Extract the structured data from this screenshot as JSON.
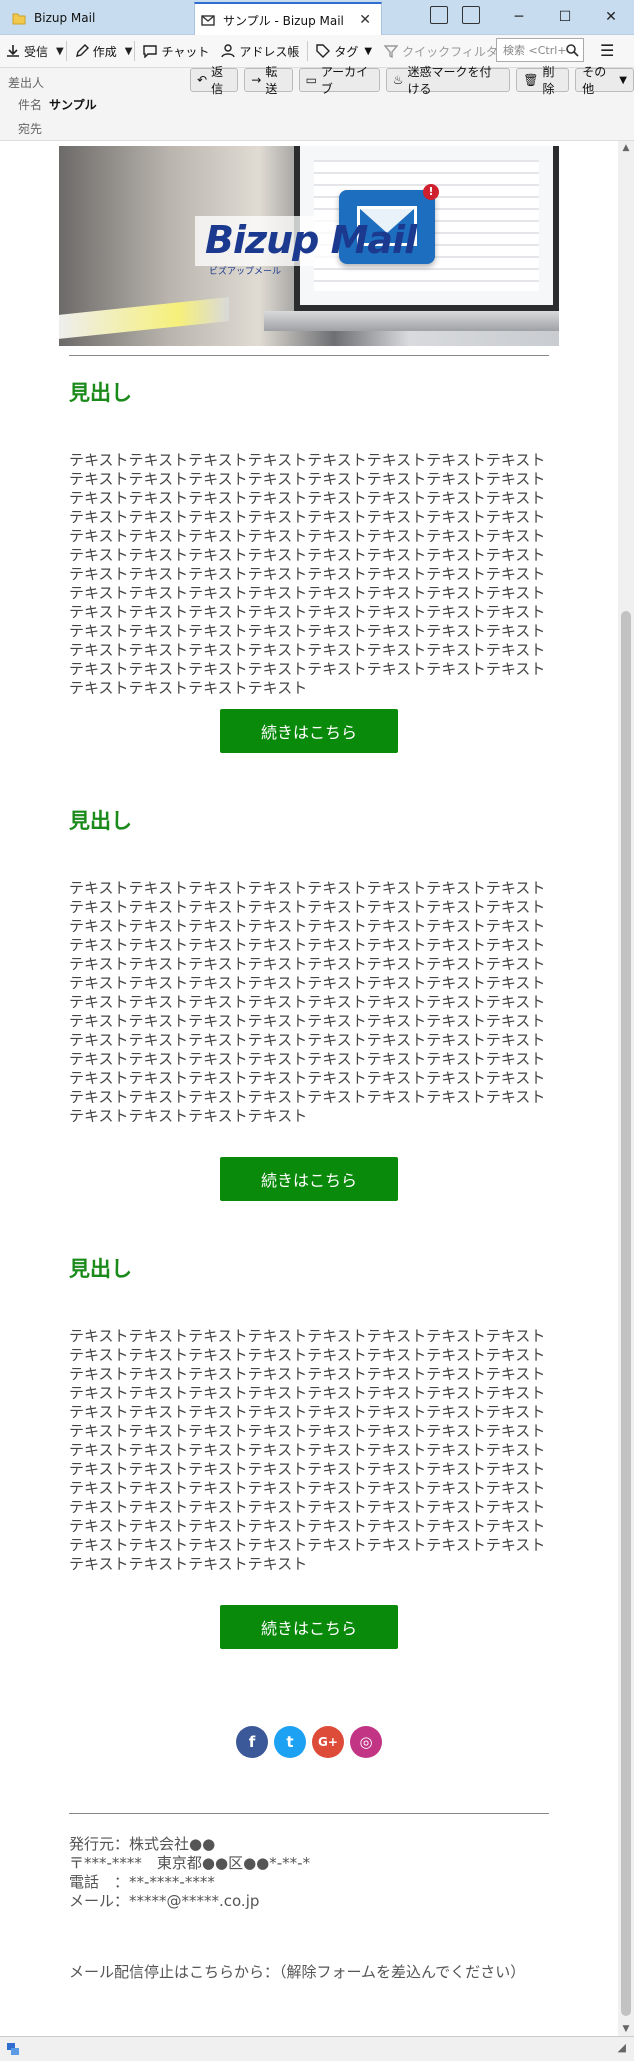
{
  "window": {
    "tab_inactive": "Bizup Mail",
    "tab_active": "サンプル - Bizup Mail",
    "tab_close": "✕",
    "minimize": "─",
    "maximize": "☐",
    "close": "✕"
  },
  "toolbar": {
    "receive": "受信",
    "compose": "作成",
    "chat": "チャット",
    "address_book": "アドレス帳",
    "tag": "タグ",
    "quick_filter": "クイックフィルター",
    "search_placeholder": "検索 <Ctrl+",
    "menu_icon": "☰"
  },
  "header": {
    "from_label": "差出人",
    "subject_label": "件名",
    "subject_value": "サンプル",
    "to_label": "宛先",
    "actions": [
      "返信",
      "転送",
      "アーカイブ",
      "迷惑マークを付ける",
      "削除",
      "その他"
    ]
  },
  "banner": {
    "logo": "Bizup Mail",
    "logo_sub": "ビズアップメール",
    "badge": "!"
  },
  "sections": [
    {
      "heading": "見出し",
      "body": "テキストテキストテキストテキストテキストテキストテキストテキストテキストテキストテキストテキストテキストテキストテキストテキストテキストテキストテキストテキストテキストテキストテキストテキストテキストテキストテキストテキストテキストテキストテキストテキストテキストテキストテキストテキストテキストテキストテキストテキストテキストテキストテキストテキストテキストテキストテキストテキストテキストテキストテキストテキストテキストテキストテキストテキストテキストテキストテキストテキストテキストテキストテキストテキストテキストテキストテキストテキストテキストテキストテキストテキストテキストテキストテキストテキストテキストテキストテキストテキストテキストテキストテキストテキストテキストテキストテキストテキストテキストテキストテキストテキストテキストテキストテキストテキストテキストテキストテキストテキスト",
      "button": "続きはこちら"
    },
    {
      "heading": "見出し",
      "body": "テキストテキストテキストテキストテキストテキストテキストテキストテキストテキストテキストテキストテキストテキストテキストテキストテキストテキストテキストテキストテキストテキストテキストテキストテキストテキストテキストテキストテキストテキストテキストテキストテキストテキストテキストテキストテキストテキストテキストテキストテキストテキストテキストテキストテキストテキストテキストテキストテキストテキストテキストテキストテキストテキストテキストテキストテキストテキストテキストテキストテキストテキストテキストテキストテキストテキストテキストテキストテキストテキストテキストテキストテキストテキストテキストテキストテキストテキストテキストテキストテキストテキストテキストテキストテキストテキストテキストテキストテキストテキストテキストテキストテキストテキストテキストテキストテキストテキストテキストテキスト",
      "button": "続きはこちら"
    },
    {
      "heading": "見出し",
      "body": "テキストテキストテキストテキストテキストテキストテキストテキストテキストテキストテキストテキストテキストテキストテキストテキストテキストテキストテキストテキストテキストテキストテキストテキストテキストテキストテキストテキストテキストテキストテキストテキストテキストテキストテキストテキストテキストテキストテキストテキストテキストテキストテキストテキストテキストテキストテキストテキストテキストテキストテキストテキストテキストテキストテキストテキストテキストテキストテキストテキストテキストテキストテキストテキストテキストテキストテキストテキストテキストテキストテキストテキストテキストテキストテキストテキストテキストテキストテキストテキストテキストテキストテキストテキストテキストテキストテキストテキストテキストテキストテキストテキストテキストテキストテキストテキストテキストテキストテキストテキスト",
      "button": "続きはこちら"
    }
  ],
  "social": [
    {
      "icon": "facebook-icon",
      "glyph": "f",
      "color": "#3b5998"
    },
    {
      "icon": "twitter-icon",
      "glyph": "t",
      "color": "#1da1f2"
    },
    {
      "icon": "google-plus-icon",
      "glyph": "G+",
      "color": "#dd4b39"
    },
    {
      "icon": "instagram-icon",
      "glyph": "◎",
      "color": "#c13584"
    }
  ],
  "footer": {
    "publisher": "発行元：株式会社●●",
    "address": "〒***-****　東京都●●区●●*-**-*",
    "phone": "電話　：**-****-****",
    "email": "メール：*****@*****.co.jp",
    "unsubscribe": "メール配信停止はこちらから：（解除フォームを差込んでください）"
  }
}
